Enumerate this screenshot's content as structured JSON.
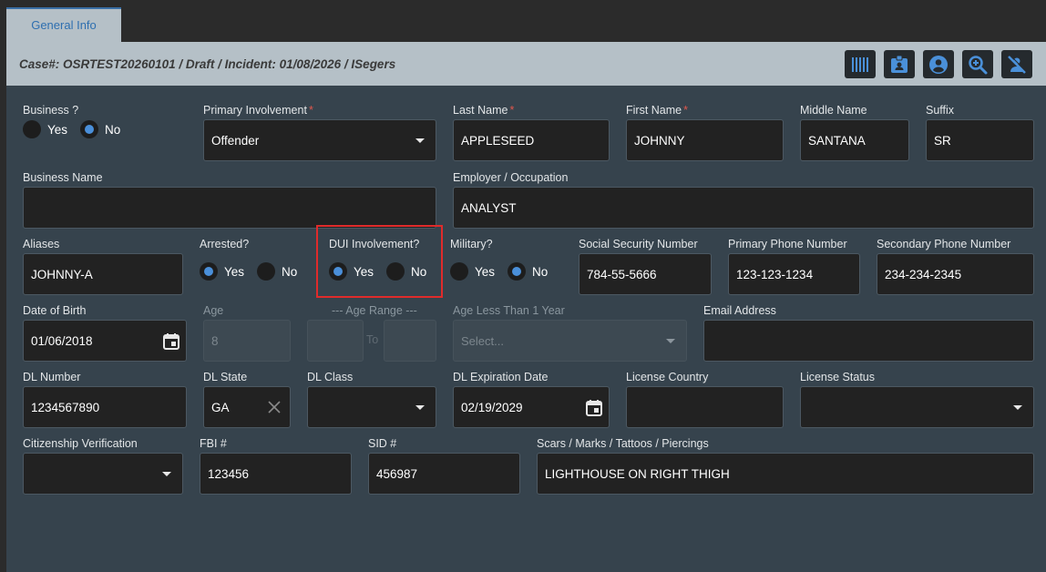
{
  "tab": {
    "label": "General Info"
  },
  "header": {
    "case_text": "Case#: OSRTEST20260101 / Draft / Incident: 01/08/2026 / ISegers"
  },
  "toolbar": {
    "icons": [
      "barcode-icon",
      "id-card-icon",
      "user-circle-icon",
      "zoom-in-icon",
      "person-off-icon"
    ]
  },
  "business": {
    "label": "Business ?",
    "yes": "Yes",
    "no": "No",
    "selected": "No"
  },
  "primary_involvement": {
    "label": "Primary Involvement",
    "value": "Offender",
    "required": "*"
  },
  "last_name": {
    "label": "Last Name",
    "value": "APPLESEED",
    "required": "*"
  },
  "first_name": {
    "label": "First Name",
    "value": "JOHNNY",
    "required": "*"
  },
  "middle_name": {
    "label": "Middle Name",
    "value": "SANTANA"
  },
  "suffix": {
    "label": "Suffix",
    "value": "SR"
  },
  "business_name": {
    "label": "Business Name",
    "value": ""
  },
  "employer": {
    "label": "Employer / Occupation",
    "value": "ANALYST"
  },
  "aliases": {
    "label": "Aliases",
    "value": "JOHNNY-A"
  },
  "arrested": {
    "label": "Arrested?",
    "yes": "Yes",
    "no": "No",
    "selected": "Yes"
  },
  "dui": {
    "label": "DUI Involvement?",
    "yes": "Yes",
    "no": "No",
    "selected": "Yes"
  },
  "military": {
    "label": "Military?",
    "yes": "Yes",
    "no": "No",
    "selected": "No"
  },
  "ssn": {
    "label": "Social Security Number",
    "value": "784-55-5666"
  },
  "primary_phone": {
    "label": "Primary Phone Number",
    "value": "123-123-1234"
  },
  "secondary_phone": {
    "label": "Secondary Phone Number",
    "value": "234-234-2345"
  },
  "dob": {
    "label": "Date of Birth",
    "value": "01/06/2018"
  },
  "age": {
    "label": "Age",
    "value": "8"
  },
  "age_range": {
    "label": "--- Age Range ---",
    "to": "To"
  },
  "age_less_1": {
    "label": "Age Less Than 1 Year",
    "placeholder": "Select..."
  },
  "email": {
    "label": "Email Address",
    "value": ""
  },
  "dl_number": {
    "label": "DL Number",
    "value": "1234567890"
  },
  "dl_state": {
    "label": "DL State",
    "value": "GA"
  },
  "dl_class": {
    "label": "DL Class",
    "value": ""
  },
  "dl_expiration": {
    "label": "DL Expiration Date",
    "value": "02/19/2029"
  },
  "license_country": {
    "label": "License Country",
    "value": ""
  },
  "license_status": {
    "label": "License Status",
    "value": ""
  },
  "citizenship": {
    "label": "Citizenship Verification",
    "value": ""
  },
  "fbi": {
    "label": "FBI #",
    "value": "123456"
  },
  "sid": {
    "label": "SID #",
    "value": "456987"
  },
  "scars": {
    "label": "Scars / Marks / Tattoos / Piercings",
    "value": "LIGHTHOUSE ON RIGHT THIGH"
  }
}
